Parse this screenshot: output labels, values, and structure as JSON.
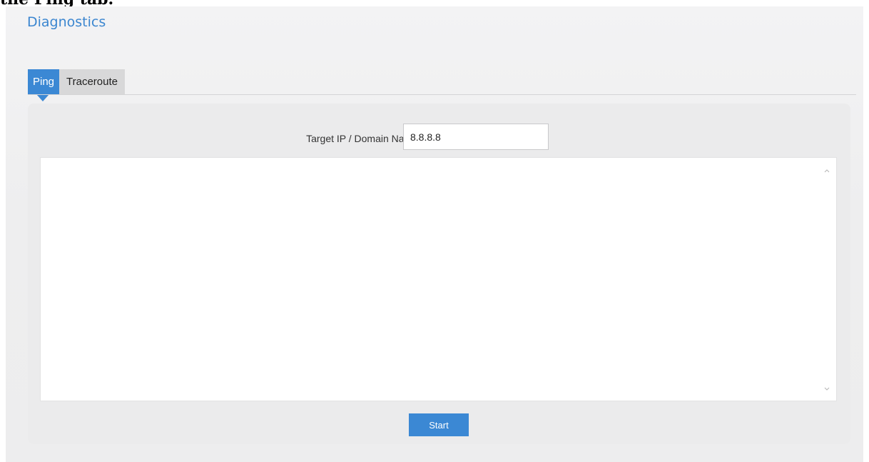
{
  "caption": "the Ping tab.",
  "page": {
    "title": "Diagnostics"
  },
  "tabs": [
    {
      "label": "Ping",
      "active": true
    },
    {
      "label": "Traceroute",
      "active": false
    }
  ],
  "form": {
    "target_label": "Target IP / Domain Name",
    "target_value": "8.8.8.8",
    "output_text": "",
    "start_label": "Start"
  },
  "icons": {
    "scroll_up": "chevron-up-icon",
    "scroll_down": "chevron-down-icon"
  },
  "colors": {
    "accent": "#3b88d4",
    "title": "#3b86d0",
    "inactive_tab": "#d8d8d9"
  }
}
